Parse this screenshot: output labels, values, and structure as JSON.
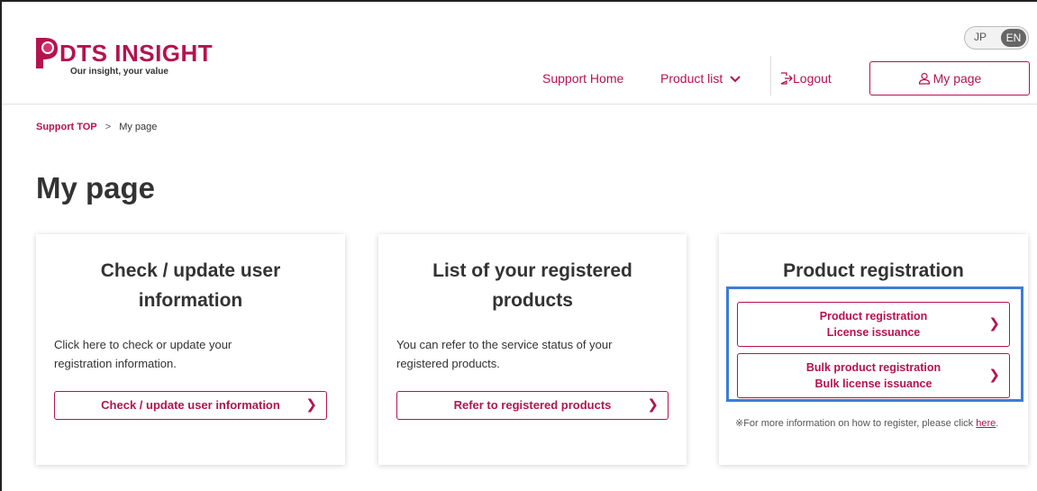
{
  "header": {
    "brand": "DTS INSIGHT",
    "tagline": "Our insight, your value",
    "lang_jp": "JP",
    "lang_en": "EN",
    "nav": {
      "support_home": "Support Home",
      "product_list": "Product list",
      "logout": "Logout",
      "my_page": "My page"
    }
  },
  "breadcrumb": {
    "top": "Support TOP",
    "sep": ">",
    "current": "My page"
  },
  "page_title": "My page",
  "cards": {
    "user": {
      "title": "Check / update user information",
      "desc": "Click here to check or update your registration information.",
      "button": "Check / update user information"
    },
    "products": {
      "title": "List of your registered products",
      "desc": "You can refer to the service status of your registered products.",
      "button": "Refer to registered products"
    },
    "registration": {
      "title": "Product registration",
      "btn1_line1": "Product registration",
      "btn1_line2": "License issuance",
      "btn2_line1": "Bulk product registration",
      "btn2_line2": "Bulk license issuance",
      "note_prefix": "※For more information on how to register, please click ",
      "note_link": "here",
      "note_suffix": "."
    }
  },
  "colors": {
    "accent": "#b4134f",
    "highlight": "#3b7dd8"
  }
}
